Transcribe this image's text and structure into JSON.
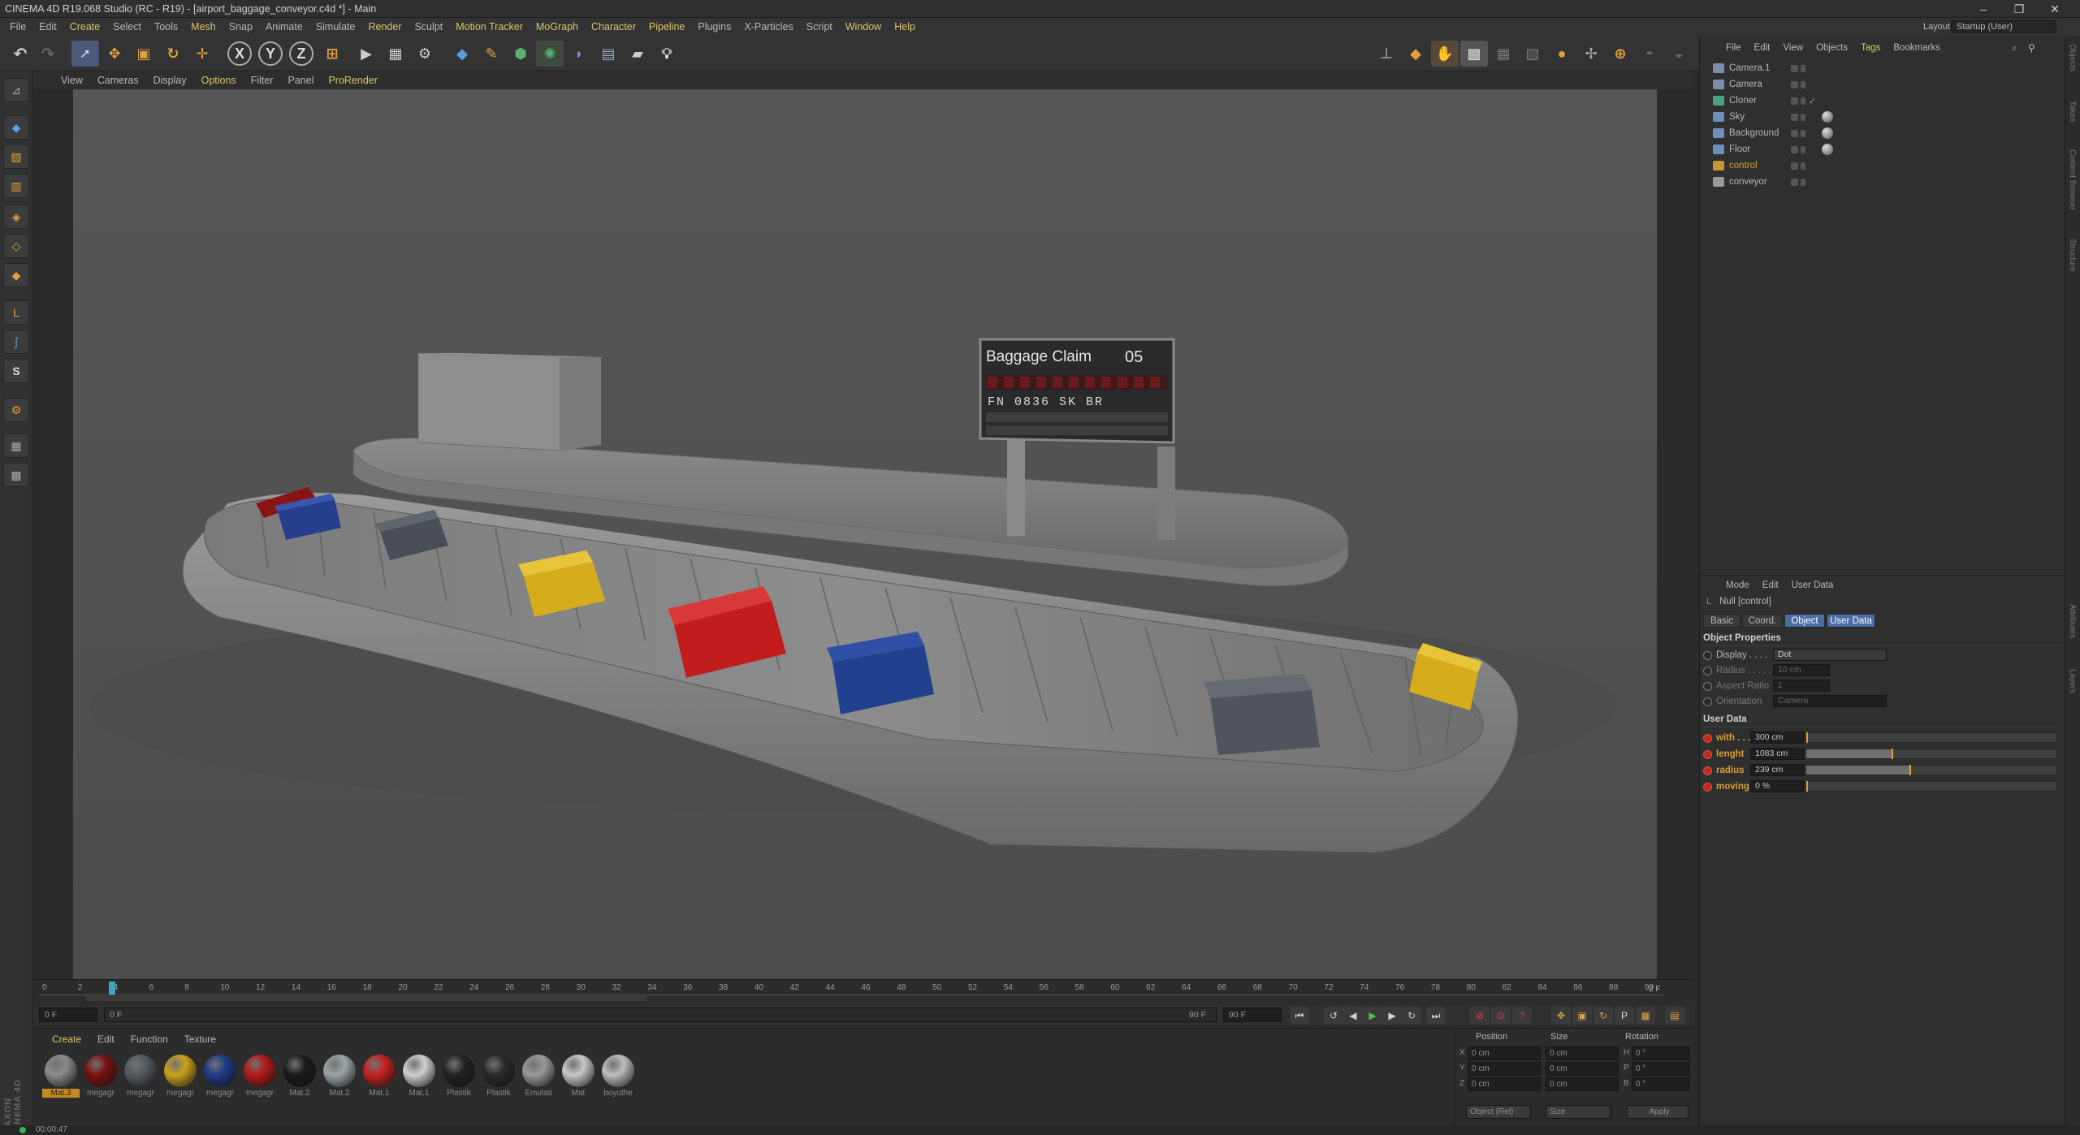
{
  "window": {
    "title": "CINEMA 4D R19.068 Studio (RC - R19) - [airport_baggage_conveyor.c4d *] - Main"
  },
  "menu": [
    "File",
    "Edit",
    "Create",
    "Select",
    "Tools",
    "Mesh",
    "Snap",
    "Animate",
    "Simulate",
    "Render",
    "Sculpt",
    "Motion Tracker",
    "MoGraph",
    "Character",
    "Pipeline",
    "Plugins",
    "X-Particles",
    "Script",
    "Window",
    "Help"
  ],
  "layout": {
    "label": "Layout:",
    "value": "Startup (User)"
  },
  "toolbar": {
    "x": "X",
    "y": "Y",
    "z": "Z"
  },
  "viewport_menu": [
    "View",
    "Cameras",
    "Display",
    "Options",
    "Filter",
    "Panel",
    "ProRender"
  ],
  "scene": {
    "sign_title": "Baggage Claim",
    "sign_number": "05",
    "board_row1": "FN 0836 SK BR"
  },
  "timeline": {
    "ticks": [
      "0",
      "2",
      "4",
      "6",
      "8",
      "10",
      "12",
      "14",
      "16",
      "18",
      "20",
      "22",
      "24",
      "26",
      "28",
      "30",
      "32",
      "34",
      "36",
      "38",
      "40",
      "42",
      "44",
      "46",
      "48",
      "50",
      "52",
      "54",
      "56",
      "58",
      "60",
      "62",
      "64",
      "66",
      "68",
      "70",
      "72",
      "74",
      "76",
      "78",
      "80",
      "82",
      "84",
      "86",
      "88",
      "90"
    ],
    "end_label": "2 F"
  },
  "transport": {
    "current": "0 F",
    "start": "0 F",
    "end": "90 F",
    "max": "90 F"
  },
  "material_menu": [
    "Create",
    "Edit",
    "Function",
    "Texture"
  ],
  "materials": [
    {
      "name": "Mat.3",
      "color": "#8a8a8a"
    },
    {
      "name": "megagr",
      "color": "#7a1010"
    },
    {
      "name": "megagr",
      "color": "#555a62"
    },
    {
      "name": "megagr",
      "color": "#c9a21a"
    },
    {
      "name": "megagr",
      "color": "#1f3a88"
    },
    {
      "name": "megagr",
      "color": "#b51818"
    },
    {
      "name": "Mat.2",
      "color": "#1a1a1a"
    },
    {
      "name": "Mat.2",
      "color": "#9aa4a6"
    },
    {
      "name": "Mat.1",
      "color": "#c42020"
    },
    {
      "name": "Mat.1",
      "color": "#d0d0d0"
    },
    {
      "name": "Plastik",
      "color": "#222"
    },
    {
      "name": "Plastik",
      "color": "#2a2a2a"
    },
    {
      "name": "Emulati",
      "color": "#999"
    },
    {
      "name": "Mat",
      "color": "#c8c8c8"
    },
    {
      "name": "boyuthe",
      "color": "#bdbdbd"
    }
  ],
  "coords": {
    "headers": [
      "Position",
      "Size",
      "Rotation"
    ],
    "rows": [
      {
        "axis": "X",
        "pos": "0 cm",
        "size": "0 cm",
        "rlabel": "H",
        "rot": "0 °"
      },
      {
        "axis": "Y",
        "pos": "0 cm",
        "size": "0 cm",
        "rlabel": "P",
        "rot": "0 °"
      },
      {
        "axis": "Z",
        "pos": "0 cm",
        "size": "0 cm",
        "rlabel": "B",
        "rot": "0 °"
      }
    ],
    "mode1": "Object (Rel)",
    "mode2": "Size",
    "apply": "Apply"
  },
  "object_menu": [
    "File",
    "Edit",
    "View",
    "Objects",
    "Tags",
    "Bookmarks"
  ],
  "objects": [
    {
      "name": "Camera.1",
      "color": "#7d8fa8"
    },
    {
      "name": "Camera",
      "color": "#7d8fa8"
    },
    {
      "name": "Cloner",
      "color": "#4aa27e"
    },
    {
      "name": "Sky",
      "color": "#6d8fbf"
    },
    {
      "name": "Background",
      "color": "#6d8fbf"
    },
    {
      "name": "Floor",
      "color": "#6d8fbf"
    },
    {
      "name": "control",
      "color": "#c9972f"
    },
    {
      "name": "conveyor",
      "color": "#9a9a9a"
    }
  ],
  "attr_menu": [
    "Mode",
    "Edit",
    "User Data"
  ],
  "attr_title": "Null [control]",
  "attr_tabs": [
    "Basic",
    "Coord.",
    "Object",
    "User Data"
  ],
  "object_props": {
    "heading": "Object Properties",
    "rows": [
      {
        "label": "Display . . . .",
        "value": "Dot"
      },
      {
        "label": "Radius . . . . .",
        "value": "10 cm"
      },
      {
        "label": "Aspect Ratio",
        "value": "1"
      },
      {
        "label": "Orientation",
        "value": "Camera"
      }
    ]
  },
  "user_data": {
    "heading": "User Data",
    "rows": [
      {
        "label": "with . . .",
        "value": "300 cm",
        "fraction": 0.0
      },
      {
        "label": "lenght",
        "value": "1083 cm",
        "fraction": 0.34
      },
      {
        "label": "radius",
        "value": "239 cm",
        "fraction": 0.41
      },
      {
        "label": "moving",
        "value": "0 %",
        "fraction": 0.0
      }
    ]
  },
  "status": {
    "time": "00:00:47"
  },
  "brand": "MAXON CINEMA 4D"
}
